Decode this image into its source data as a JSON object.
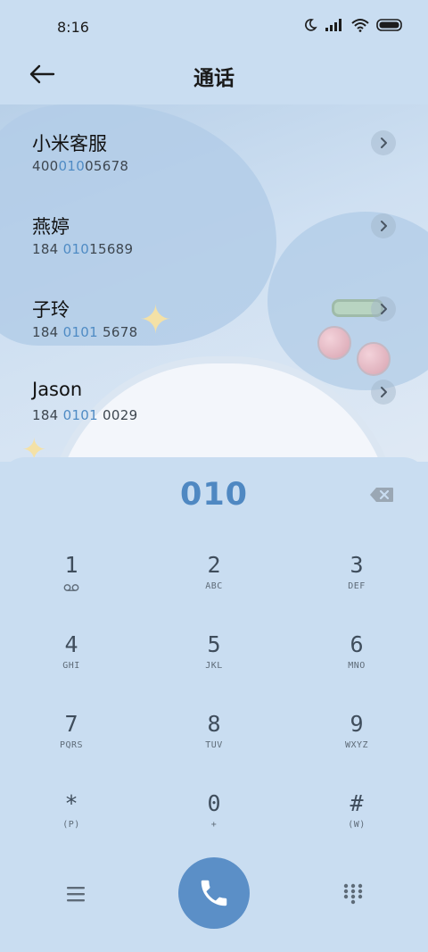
{
  "status_bar": {
    "time": "8:16",
    "icons": [
      "moon-icon",
      "signal-icon",
      "wifi-icon",
      "battery-icon"
    ]
  },
  "header": {
    "title": "通话",
    "back_icon": "arrow-left-icon"
  },
  "contacts": [
    {
      "name": "小米客服",
      "number_before": "400",
      "number_match": "010",
      "number_after": "05678"
    },
    {
      "name": "燕婷",
      "number_before": "184 ",
      "number_match": "010",
      "number_after": "15689"
    },
    {
      "name": "子玲",
      "number_before": "184 ",
      "number_match": "0101",
      "number_after": " 5678"
    },
    {
      "name": "Jason",
      "number_before": "184 ",
      "number_match": "0101",
      "number_after": " 0029"
    }
  ],
  "dialer": {
    "input": "010",
    "keys": [
      {
        "digit": "1",
        "letters": ""
      },
      {
        "digit": "2",
        "letters": "ABC"
      },
      {
        "digit": "3",
        "letters": "DEF"
      },
      {
        "digit": "4",
        "letters": "GHI"
      },
      {
        "digit": "5",
        "letters": "JKL"
      },
      {
        "digit": "6",
        "letters": "MNO"
      },
      {
        "digit": "7",
        "letters": "PQRS"
      },
      {
        "digit": "8",
        "letters": "TUV"
      },
      {
        "digit": "9",
        "letters": "WXYZ"
      },
      {
        "digit": "*",
        "letters": "(P)"
      },
      {
        "digit": "0",
        "letters": "+"
      },
      {
        "digit": "#",
        "letters": "(W)"
      }
    ],
    "bottom_icons": [
      "menu-icon",
      "phone-icon",
      "keypad-icon"
    ]
  },
  "colors": {
    "accent": "#4f88c2",
    "call_button": "#5b8fc7",
    "panel": "#c9ddf1"
  }
}
